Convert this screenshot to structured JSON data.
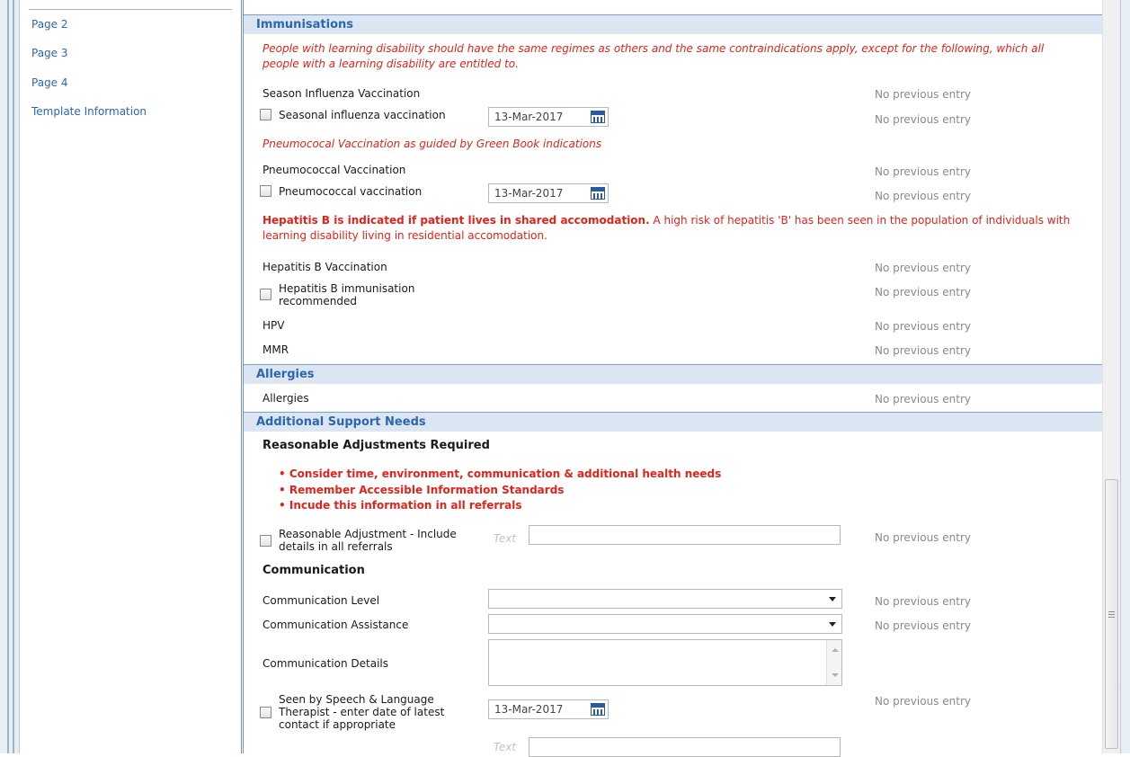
{
  "nav": {
    "items": [
      {
        "label": "Page 2"
      },
      {
        "label": "Page 3"
      },
      {
        "label": "Page 4"
      },
      {
        "label": "Template Information"
      }
    ]
  },
  "immunisations": {
    "title": "Immunisations",
    "intro": "People with learning disability should have the same regimes as others and the same contraindications apply, except for the following, which all people with a learning disability are entitled to.",
    "season_label": "Season Influenza Vaccination",
    "season_prev": "No previous entry",
    "seasonal_cb_label": "Seasonal influenza vaccination",
    "seasonal_date": "13-Mar-2017",
    "seasonal_prev": "No previous entry",
    "pneumo_note": "Pneumococal Vaccination as guided by Green Book indications",
    "pneumo_label": "Pneumococcal Vaccination",
    "pneumo_prev": "No previous entry",
    "pneumo_cb_label": "Pneumococcal vaccination",
    "pneumo_date": "13-Mar-2017",
    "pneumo_cb_prev": "No previous entry",
    "hepb_note_bold": "Hepatitis B is indicated if patient lives in shared accomodation.",
    "hepb_note_rest": " A high risk of hepatitis 'B' has been seen in the population of individuals with learning disability living in residential accomodation.",
    "hepb_label": "Hepatitis B Vaccination",
    "hepb_prev": "No previous entry",
    "hepb_cb_label_1": "Hepatitis B immunisation",
    "hepb_cb_label_2": "recommended",
    "hepb_cb_prev": "No previous entry",
    "hpv_label": "HPV",
    "hpv_prev": "No previous entry",
    "mmr_label": "MMR",
    "mmr_prev": "No previous entry"
  },
  "allergies": {
    "title": "Allergies",
    "label": "Allergies",
    "prev": "No previous entry"
  },
  "support": {
    "title": "Additional Support Needs",
    "adjustments_heading": "Reasonable Adjustments Required",
    "bullets": [
      "• Consider time, environment, communication & additional health needs",
      "• Remember Accessible Information Standards",
      "• Incude this information in all referrals"
    ],
    "adj_cb_label_1": "Reasonable Adjustment - Include",
    "adj_cb_label_2": "details in all referrals",
    "adj_text_placeholder": "Text",
    "adj_prev": "No previous entry",
    "communication_heading": "Communication",
    "comm_level_label": "Communication Level",
    "comm_level_prev": "No previous entry",
    "comm_assist_label": "Communication Assistance",
    "comm_assist_prev": "No previous entry",
    "comm_details_label": "Communication Details",
    "salt_cb_label_1": "Seen by Speech & Language",
    "salt_cb_label_2": "Therapist - enter date of latest",
    "salt_cb_label_3": "contact if appropriate",
    "salt_date": "13-Mar-2017",
    "salt_prev": "No previous entry",
    "salt_text_placeholder": "Text"
  }
}
